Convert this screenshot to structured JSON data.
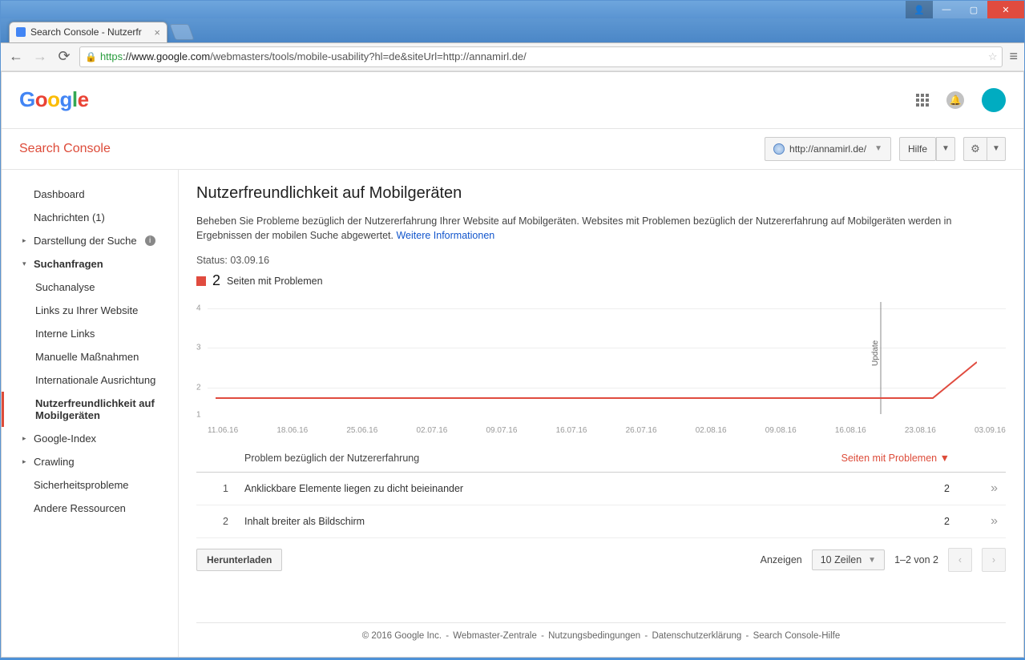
{
  "browser": {
    "tab_title": "Search Console - Nutzerfr",
    "url_scheme": "https",
    "url_host": "://www.google.com",
    "url_path": "/webmasters/tools/mobile-usability?hl=de&siteUrl=http://annamirl.de/"
  },
  "header": {
    "product": "Search Console",
    "site_selector": "http://annamirl.de/",
    "help_label": "Hilfe"
  },
  "sidebar": {
    "dashboard": "Dashboard",
    "messages": "Nachrichten (1)",
    "appearance": "Darstellung der Suche",
    "queries": "Suchanfragen",
    "sub": {
      "analysis": "Suchanalyse",
      "links": "Links zu Ihrer Website",
      "internal": "Interne Links",
      "manual": "Manuelle Maßnahmen",
      "intl": "Internationale Ausrichtung",
      "mobile": "Nutzerfreundlichkeit auf Mobilgeräten"
    },
    "gindex": "Google-Index",
    "crawling": "Crawling",
    "security": "Sicherheitsprobleme",
    "other": "Andere Ressourcen"
  },
  "main": {
    "title": "Nutzerfreundlichkeit auf Mobilgeräten",
    "description": "Beheben Sie Probleme bezüglich der Nutzererfahrung Ihrer Website auf Mobilgeräten. Websites mit Problemen bezüglich der Nutzererfahrung auf Mobilgeräten werden in Ergebnissen der mobilen Suche abgewertet. ",
    "more_link": "Weitere Informationen",
    "status": "Status: 03.09.16",
    "legend_count": "2",
    "legend_label": "Seiten mit Problemen",
    "update_label": "Update"
  },
  "chart_data": {
    "type": "line",
    "title": "Seiten mit Problemen",
    "xlabel": "",
    "ylabel": "",
    "ylim": [
      1,
      4
    ],
    "y_ticks": [
      1,
      2,
      3,
      4
    ],
    "x_ticks": [
      "11.06.16",
      "18.06.16",
      "25.06.16",
      "02.07.16",
      "09.07.16",
      "16.07.16",
      "26.07.16",
      "02.08.16",
      "09.08.16",
      "16.08.16",
      "23.08.16",
      "03.09.16"
    ],
    "series": [
      {
        "name": "Seiten mit Problemen",
        "color": "#e04b3f",
        "x": [
          "11.06.16",
          "23.08.16",
          "01.09.16",
          "03.09.16"
        ],
        "y": [
          1,
          1,
          1,
          2
        ]
      }
    ],
    "annotations": [
      {
        "x": "23.08.16",
        "label": "Update"
      }
    ]
  },
  "table": {
    "col_issue": "Problem bezüglich der Nutzererfahrung",
    "col_pages": "Seiten mit Problemen",
    "rows": [
      {
        "n": "1",
        "issue": "Anklickbare Elemente liegen zu dicht beieinander",
        "pages": "2"
      },
      {
        "n": "2",
        "issue": "Inhalt breiter als Bildschirm",
        "pages": "2"
      }
    ],
    "download": "Herunterladen",
    "show_label": "Anzeigen",
    "rows_select": "10 Zeilen",
    "range": "1–2 von 2"
  },
  "footer": {
    "c1": "© 2016 Google Inc.",
    "c2": "Webmaster-Zentrale",
    "c3": "Nutzungsbedingungen",
    "c4": "Datenschutzerklärung",
    "c5": "Search Console-Hilfe"
  }
}
